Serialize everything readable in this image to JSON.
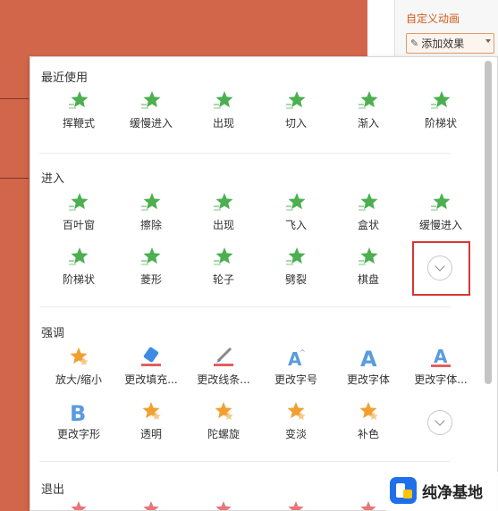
{
  "right_pane": {
    "title": "自定义动画",
    "add_effect_label": "添加效果"
  },
  "popup": {
    "sections": [
      {
        "title": "最近使用",
        "items": [
          {
            "label": "挥鞭式",
            "icon": "star-entrance-icon"
          },
          {
            "label": "缓慢进入",
            "icon": "star-entrance-icon"
          },
          {
            "label": "出现",
            "icon": "star-entrance-icon"
          },
          {
            "label": "切入",
            "icon": "star-entrance-icon"
          },
          {
            "label": "渐入",
            "icon": "star-entrance-icon"
          },
          {
            "label": "阶梯状",
            "icon": "star-entrance-icon"
          }
        ]
      },
      {
        "title": "进入",
        "items": [
          {
            "label": "百叶窗",
            "icon": "star-entrance-icon"
          },
          {
            "label": "擦除",
            "icon": "star-entrance-icon"
          },
          {
            "label": "出现",
            "icon": "star-entrance-icon"
          },
          {
            "label": "飞入",
            "icon": "star-entrance-icon"
          },
          {
            "label": "盒状",
            "icon": "star-entrance-icon"
          },
          {
            "label": "缓慢进入",
            "icon": "star-entrance-icon"
          },
          {
            "label": "阶梯状",
            "icon": "star-entrance-icon"
          },
          {
            "label": "菱形",
            "icon": "star-entrance-icon"
          },
          {
            "label": "轮子",
            "icon": "star-entrance-icon"
          },
          {
            "label": "劈裂",
            "icon": "star-entrance-icon"
          },
          {
            "label": "棋盘",
            "icon": "star-entrance-icon"
          }
        ]
      },
      {
        "title": "强调",
        "items": [
          {
            "label": "放大/缩小",
            "icon": "star-emphasis-icon"
          },
          {
            "label": "更改填充...",
            "icon": "fill-bucket-icon"
          },
          {
            "label": "更改线条...",
            "icon": "pen-line-icon"
          },
          {
            "label": "更改字号",
            "icon": "font-size-icon"
          },
          {
            "label": "更改字体",
            "icon": "font-letter-icon"
          },
          {
            "label": "更改字体...",
            "icon": "font-color-icon"
          },
          {
            "label": "更改字形",
            "icon": "font-bold-icon"
          },
          {
            "label": "透明",
            "icon": "star-emphasis-icon"
          },
          {
            "label": "陀螺旋",
            "icon": "star-emphasis-icon"
          },
          {
            "label": "变淡",
            "icon": "star-emphasis-icon"
          },
          {
            "label": "补色",
            "icon": "star-emphasis-icon"
          }
        ]
      },
      {
        "title": "退出",
        "items": []
      }
    ]
  },
  "watermark": {
    "text": "纯净基地"
  },
  "colors": {
    "slide_bg": "#d2664a",
    "accent_orange": "#d25b1f",
    "entrance_green": "#4caf50",
    "emphasis_orange": "#f0a030",
    "exit_red": "#e06060",
    "highlight_red": "#d83535"
  }
}
